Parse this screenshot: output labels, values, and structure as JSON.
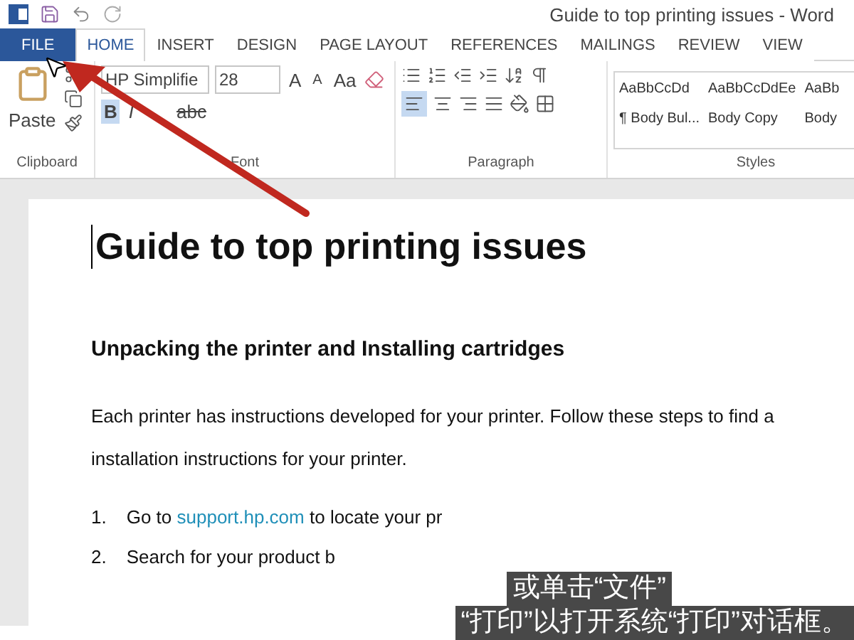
{
  "window": {
    "title": "Guide to top printing issues - Word"
  },
  "tabs": [
    {
      "label": "FILE",
      "selected": false,
      "kind": "file"
    },
    {
      "label": "HOME",
      "selected": true,
      "kind": "tab"
    },
    {
      "label": "INSERT",
      "selected": false,
      "kind": "tab"
    },
    {
      "label": "DESIGN",
      "selected": false,
      "kind": "tab"
    },
    {
      "label": "PAGE LAYOUT",
      "selected": false,
      "kind": "tab"
    },
    {
      "label": "REFERENCES",
      "selected": false,
      "kind": "tab"
    },
    {
      "label": "MAILINGS",
      "selected": false,
      "kind": "tab"
    },
    {
      "label": "REVIEW",
      "selected": false,
      "kind": "tab"
    },
    {
      "label": "VIEW",
      "selected": false,
      "kind": "tab"
    }
  ],
  "ribbon": {
    "clipboard": {
      "label": "Clipboard",
      "paste": "Paste"
    },
    "font": {
      "label": "Font",
      "font_name": "HP Simplifie",
      "font_size": "28",
      "grow": "A",
      "shrink": "A",
      "case": "Aa",
      "buttons": [
        {
          "label": "B",
          "selected": true,
          "kind": "bold"
        },
        {
          "label": "I",
          "selected": false,
          "kind": "italic"
        },
        {
          "label": "abc",
          "selected": false,
          "kind": "strike"
        }
      ]
    },
    "paragraph": {
      "label": "Paragraph",
      "align_left_selected": true
    },
    "styles": {
      "label": "Styles",
      "items": [
        {
          "preview": "AaBbCcDd",
          "name": "¶ Body Bul..."
        },
        {
          "preview": "AaBbCcDdEe",
          "name": "Body Copy"
        },
        {
          "preview": "AaBb",
          "name": "Body"
        }
      ]
    }
  },
  "document": {
    "title": "Guide to top printing issues",
    "heading": "Unpacking the printer and Installing cartridges",
    "paragraph": "Each printer has instructions developed for your printer.  Follow these steps to find a",
    "paragraph_2": "installation instructions for your printer.",
    "list": [
      {
        "number": "1.",
        "text": "Go to **support.hp.com** to locate your pr"
      },
      {
        "number": "2.",
        "text": "Search for your product b"
      }
    ]
  },
  "subtitles": [
    "或单击“文件”",
    "“打印”以打开系统“打印”对话框。"
  ]
}
